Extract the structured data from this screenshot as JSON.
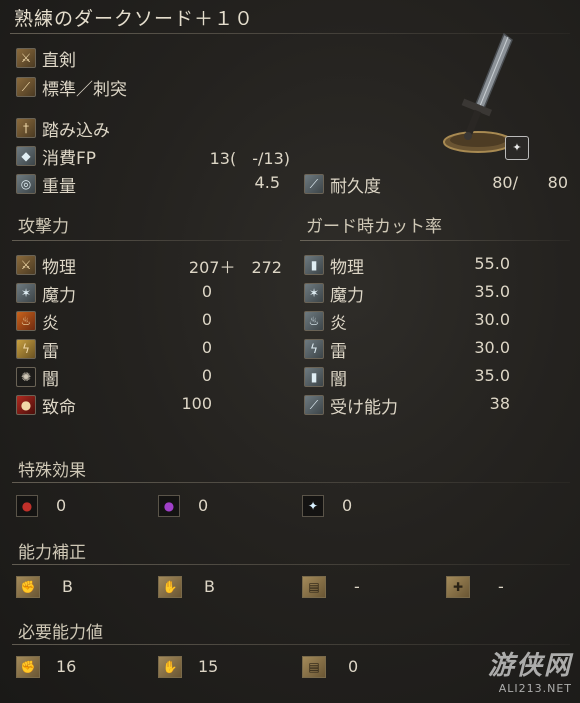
{
  "weapon": {
    "name": "熟練のダークソード＋１０",
    "type": "直剣",
    "attack_type": "標準／刺突",
    "skill": "踏み込み"
  },
  "fp": {
    "label": "消費FP",
    "value": "13(　-/13)"
  },
  "weight": {
    "label": "重量",
    "value": "4.5"
  },
  "durability": {
    "label": "耐久度",
    "current": "80/",
    "max": "80"
  },
  "attack": {
    "header": "攻撃力",
    "rows": [
      {
        "label": "物理",
        "value": "207＋　272",
        "icon": "physical-icon"
      },
      {
        "label": "魔力",
        "value": "0",
        "icon": "magic-icon"
      },
      {
        "label": "炎",
        "value": "0",
        "icon": "fire-icon"
      },
      {
        "label": "雷",
        "value": "0",
        "icon": "lightning-icon"
      },
      {
        "label": "闇",
        "value": "0",
        "icon": "dark-icon"
      },
      {
        "label": "致命",
        "value": "100",
        "icon": "critical-icon"
      }
    ]
  },
  "guard": {
    "header": "ガード時カット率",
    "rows": [
      {
        "label": "物理",
        "value": "55.0",
        "icon": "physical-guard-icon"
      },
      {
        "label": "魔力",
        "value": "35.0",
        "icon": "magic-guard-icon"
      },
      {
        "label": "炎",
        "value": "30.0",
        "icon": "fire-guard-icon"
      },
      {
        "label": "雷",
        "value": "30.0",
        "icon": "lightning-guard-icon"
      },
      {
        "label": "闇",
        "value": "35.0",
        "icon": "dark-guard-icon"
      },
      {
        "label": "受け能力",
        "value": "38",
        "icon": "stability-icon"
      }
    ]
  },
  "special": {
    "header": "特殊効果",
    "items": [
      {
        "icon": "bleed-icon",
        "value": "0"
      },
      {
        "icon": "poison-icon",
        "value": "0"
      },
      {
        "icon": "frost-icon",
        "value": "0"
      }
    ]
  },
  "scaling": {
    "header": "能力補正",
    "items": [
      {
        "icon": "strength-icon",
        "value": "B"
      },
      {
        "icon": "dexterity-icon",
        "value": "B"
      },
      {
        "icon": "intelligence-icon",
        "value": "-"
      },
      {
        "icon": "faith-icon",
        "value": "-"
      }
    ]
  },
  "requirements": {
    "header": "必要能力値",
    "items": [
      {
        "icon": "strength-req-icon",
        "value": "16"
      },
      {
        "icon": "dexterity-req-icon",
        "value": "15"
      },
      {
        "icon": "intelligence-req-icon",
        "value": "0"
      }
    ]
  },
  "watermark": {
    "text": "ALI213.NET"
  }
}
